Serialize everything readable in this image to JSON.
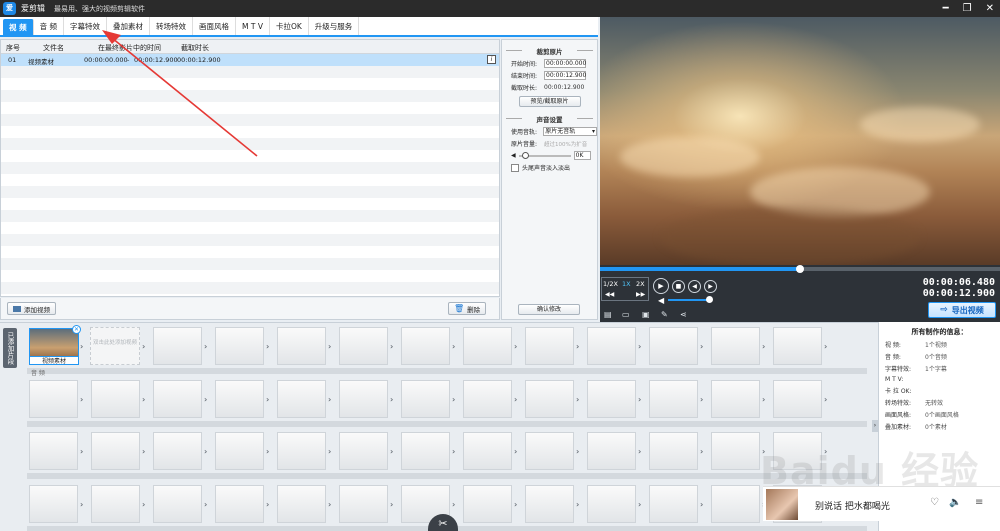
{
  "titlebar": {
    "logo": "爱",
    "app_name": "爱剪辑",
    "slogan": "最易用、强大的视频剪辑软件",
    "min": "━",
    "max": "❐",
    "close": "✕"
  },
  "tabs": [
    {
      "label": "视  频",
      "active": true
    },
    {
      "label": "音  频"
    },
    {
      "label": "字幕特效"
    },
    {
      "label": "叠加素材"
    },
    {
      "label": "转场特效"
    },
    {
      "label": "画面风格"
    },
    {
      "label": "M T V"
    },
    {
      "label": "卡拉OK"
    },
    {
      "label": "升级与服务"
    }
  ],
  "filelist": {
    "headers": {
      "index": "序号",
      "name": "文件名",
      "start": "在最终影片中的时间",
      "duration": "截取时长"
    },
    "rows": [
      {
        "index": "01",
        "name": "视频素材",
        "start": "00:00:00.000",
        "sep": "-",
        "end": "00:00:12.900",
        "duration": "00:00:12.900"
      }
    ],
    "info_icon": "i",
    "add_button": "添加视频",
    "delete_button": "删除"
  },
  "clip_settings": {
    "title": "裁剪原片",
    "start_label": "开始时间:",
    "start_value": "00:00:00.000",
    "end_label": "结束时间:",
    "end_value": "00:00:12.900",
    "duration_label": "截取时长:",
    "duration_value": "00:00:12.900",
    "preview_button": "预览/截取原片"
  },
  "audio_settings": {
    "title": "声音设置",
    "track_label": "使用音轨:",
    "track_value": "原片无音轨",
    "volume_label": "原片音量:",
    "volume_hint": "超过100%为扩音",
    "vol_icon": "◀",
    "vol_value": "0K",
    "fade_label": "头尾声音淡入淡出",
    "confirm_button": "确认修改"
  },
  "player": {
    "progress": 0.5,
    "speeds": [
      {
        "label": "1/2X"
      },
      {
        "label": "1X",
        "active": true
      },
      {
        "label": "2X"
      }
    ],
    "time_current": "00:00:06.480",
    "time_total": "00:00:12.900",
    "export_button": "导出视频"
  },
  "timeline": {
    "side_tab": "已添加片段",
    "clip_label": "视频素材",
    "add_hint": "双击此处添加视频",
    "audio_label": "音 频",
    "scissor": "✂"
  },
  "info": {
    "title": "所有制作的信息：",
    "rows": [
      {
        "k": "视      频:",
        "v": "1个视频"
      },
      {
        "k": "音      频:",
        "v": "0个音频"
      },
      {
        "k": "字幕特效:",
        "v": "1个字幕"
      },
      {
        "k": "M   T   V:",
        "v": ""
      },
      {
        "k": "卡 拉 OK:",
        "v": ""
      },
      {
        "k": "转场特效:",
        "v": "无转效"
      },
      {
        "k": "画面风格:",
        "v": "0个画面风格"
      },
      {
        "k": "叠加素材:",
        "v": "0个素材"
      }
    ]
  },
  "music": {
    "text": "别说话 把水都喝光",
    "heart": "♡",
    "speaker": "🔈",
    "next": "≡"
  },
  "watermark": "Baidu 经验"
}
